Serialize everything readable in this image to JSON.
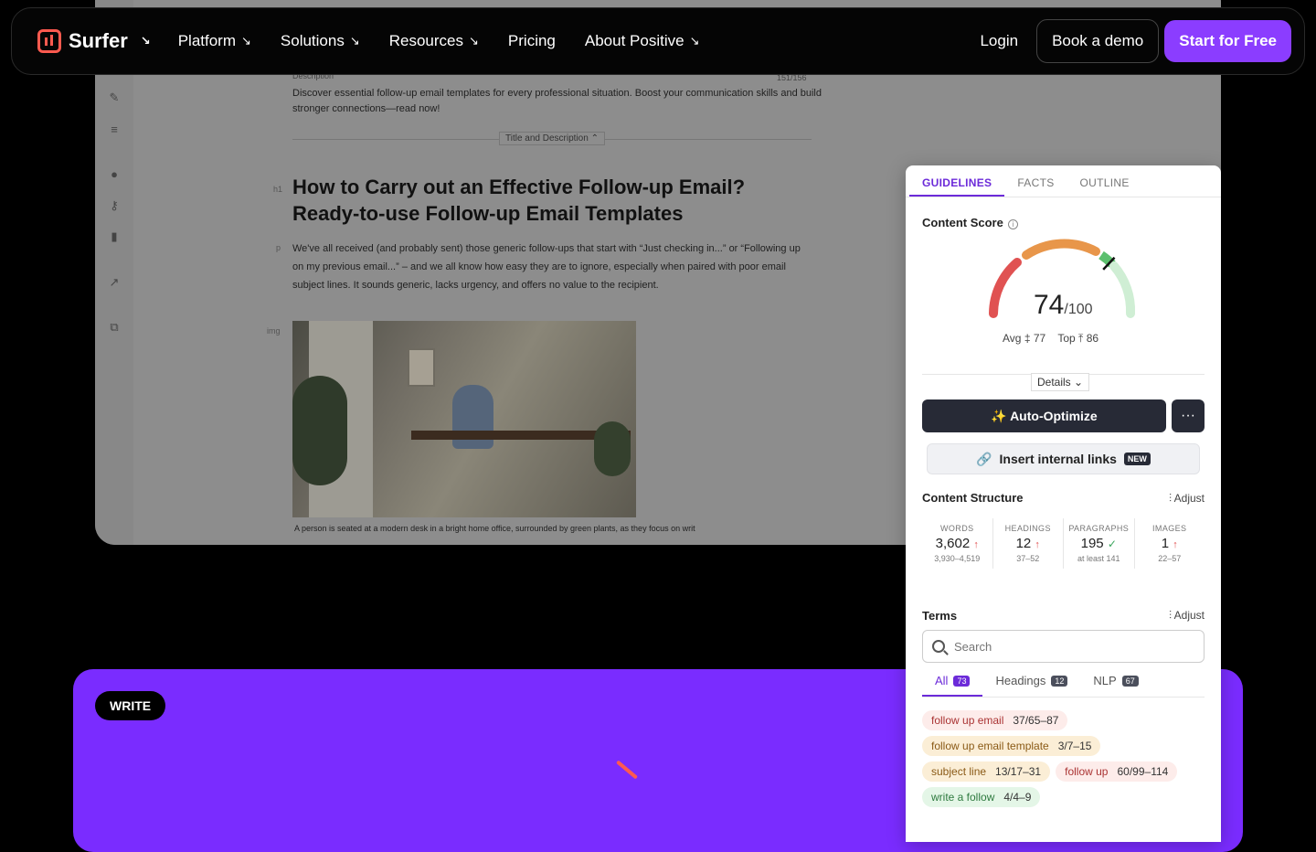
{
  "nav": {
    "brand": "Surfer",
    "items": [
      {
        "label": "Platform",
        "arrow": true
      },
      {
        "label": "Solutions",
        "arrow": true
      },
      {
        "label": "Resources",
        "arrow": true
      },
      {
        "label": "Pricing",
        "arrow": false
      },
      {
        "label": "About Positive",
        "arrow": true
      }
    ],
    "login": "Login",
    "demo": "Book a demo",
    "cta": "Start for Free"
  },
  "editor": {
    "meta_label": "Description",
    "meta_count": "151/156",
    "description": "Discover essential follow-up email templates for every professional situation. Boost your communication skills and build stronger connections—read now!",
    "toggle": "Title and Description",
    "h1_tag": "h1",
    "p_tag": "p",
    "img_tag": "img",
    "heading": "How to Carry out an Effective Follow-up Email? Ready-to-use Follow-up Email Templates",
    "paragraph": "We've all received (and probably sent) those generic follow-ups that start with “Just checking in...” or “Following up on my previous email...” – and we all know how easy they are to ignore, especially when paired with poor email subject lines. It sounds generic, lacks urgency, and offers no value to the recipient.",
    "caption": "A person is seated at a modern desk in a bright home office, surrounded by green plants, as they focus on writ"
  },
  "panel": {
    "tabs": [
      "GUIDELINES",
      "FACTS",
      "OUTLINE"
    ],
    "content_score_title": "Content Score",
    "score": "74",
    "score_max": "/100",
    "score_fraction": 0.74,
    "avg_label": "Avg",
    "avg": "77",
    "top_label": "Top",
    "top": "86",
    "details": "Details",
    "auto_optimize": "✨ Auto-Optimize",
    "more": "···",
    "insert_links": "Insert internal links",
    "new_badge": "NEW",
    "structure_title": "Content Structure",
    "adjust": "Adjust",
    "stats": [
      {
        "label": "WORDS",
        "value": "3,602",
        "range": "3,930–4,519",
        "status": "up"
      },
      {
        "label": "HEADINGS",
        "value": "12",
        "range": "37–52",
        "status": "up"
      },
      {
        "label": "PARAGRAPHS",
        "value": "195",
        "range": "at least 141",
        "status": "ok"
      },
      {
        "label": "IMAGES",
        "value": "1",
        "range": "22–57",
        "status": "up"
      }
    ],
    "terms_title": "Terms",
    "search_placeholder": "Search",
    "term_tabs": [
      {
        "label": "All",
        "count": "73"
      },
      {
        "label": "Headings",
        "count": "12"
      },
      {
        "label": "NLP",
        "count": "67"
      }
    ],
    "chips": [
      [
        {
          "term": "follow up email",
          "n": "37/65–87",
          "tone": "red"
        }
      ],
      [
        {
          "term": "follow up email template",
          "n": "3/7–15",
          "tone": "orange"
        }
      ],
      [
        {
          "term": "subject line",
          "n": "13/17–31",
          "tone": "orange"
        },
        {
          "term": "follow up",
          "n": "60/99–114",
          "tone": "red"
        }
      ],
      [
        {
          "term": "write a follow",
          "n": "4/4–9",
          "tone": "green"
        }
      ]
    ]
  },
  "section": {
    "pill": "WRITE"
  },
  "colors": {
    "accent": "#8b3dff",
    "brand": "#ff5a4f",
    "purple_bg": "#7a2cff"
  }
}
